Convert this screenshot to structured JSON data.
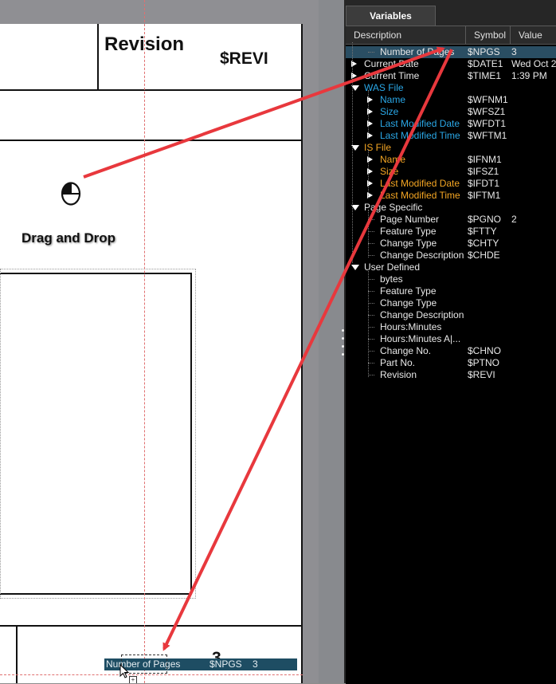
{
  "document": {
    "revision_title": "Revision",
    "revision_symbol": "$REVI",
    "drag_drop_label": "Drag and Drop",
    "page_number": "3",
    "drag_tooltip": {
      "description": "Number of Pages",
      "symbol": "$NPGS",
      "value": "3"
    }
  },
  "panel": {
    "tab_label": "Variables",
    "columns": {
      "description": "Description",
      "symbol": "Symbol",
      "value": "Value"
    },
    "rows": [
      {
        "desc": "Number of Pages",
        "symbol": "$NPGS",
        "value": "3"
      },
      {
        "desc": "Current Date",
        "symbol": "$DATE1",
        "value": "Wed Oct 2"
      },
      {
        "desc": "Current Time",
        "symbol": "$TIME1",
        "value": "1:39 PM"
      },
      {
        "desc": "WAS File",
        "symbol": "",
        "value": ""
      },
      {
        "desc": "Name",
        "symbol": "$WFNM1",
        "value": ""
      },
      {
        "desc": "Size",
        "symbol": "$WFSZ1",
        "value": ""
      },
      {
        "desc": "Last Modified Date",
        "symbol": "$WFDT1",
        "value": ""
      },
      {
        "desc": "Last Modified Time",
        "symbol": "$WFTM1",
        "value": ""
      },
      {
        "desc": "IS File",
        "symbol": "",
        "value": ""
      },
      {
        "desc": "Name",
        "symbol": "$IFNM1",
        "value": ""
      },
      {
        "desc": "Size",
        "symbol": "$IFSZ1",
        "value": ""
      },
      {
        "desc": "Last Modified Date",
        "symbol": "$IFDT1",
        "value": ""
      },
      {
        "desc": "Last Modified Time",
        "symbol": "$IFTM1",
        "value": ""
      },
      {
        "desc": "Page Specific",
        "symbol": "",
        "value": ""
      },
      {
        "desc": "Page Number",
        "symbol": "$PGNO",
        "value": "2"
      },
      {
        "desc": "Feature Type",
        "symbol": "$FTTY",
        "value": ""
      },
      {
        "desc": "Change Type",
        "symbol": "$CHTY",
        "value": ""
      },
      {
        "desc": "Change Description",
        "symbol": "$CHDE",
        "value": ""
      },
      {
        "desc": "User Defined",
        "symbol": "",
        "value": ""
      },
      {
        "desc": "bytes",
        "symbol": "",
        "value": ""
      },
      {
        "desc": "Feature Type",
        "symbol": "",
        "value": ""
      },
      {
        "desc": "Change Type",
        "symbol": "",
        "value": ""
      },
      {
        "desc": "Change Description",
        "symbol": "",
        "value": ""
      },
      {
        "desc": "Hours:Minutes",
        "symbol": "",
        "value": ""
      },
      {
        "desc": "Hours:Minutes A|...",
        "symbol": "",
        "value": ""
      },
      {
        "desc": "Change No.",
        "symbol": "$CHNO",
        "value": ""
      },
      {
        "desc": "Part No.",
        "symbol": "$PTNO",
        "value": ""
      },
      {
        "desc": "Revision",
        "symbol": "$REVI",
        "value": ""
      }
    ]
  },
  "colors": {
    "was_file": "#2aa7e6",
    "is_file": "#f5a623",
    "annotation_arrow": "#e8383d",
    "selection": "#2a4e63"
  }
}
